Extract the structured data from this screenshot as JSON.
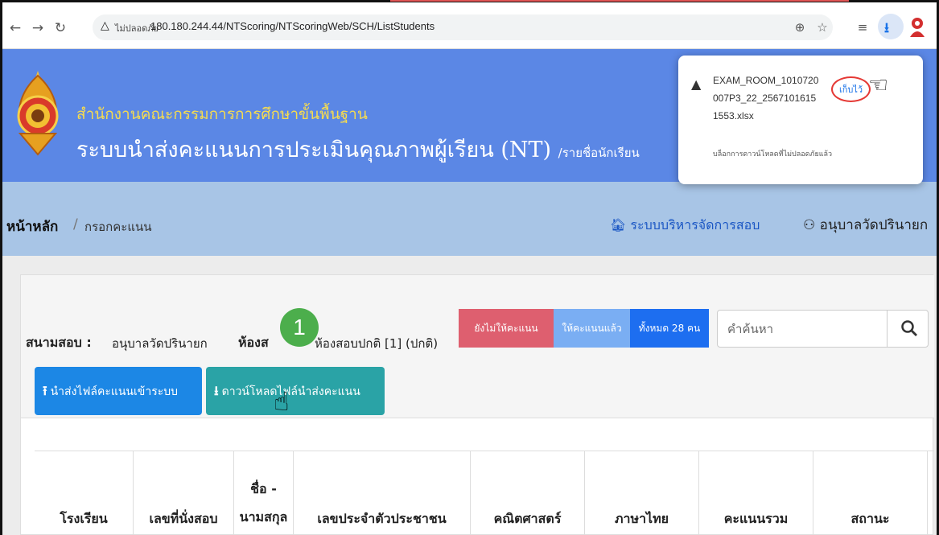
{
  "browser": {
    "not_secure": "ไม่ปลอดภัย",
    "url": "180.180.244.44/NTScoring/NTScoringWeb/SCH/ListStudents"
  },
  "download_popup": {
    "file_name_line1": "EXAM_ROOM_1010720",
    "file_name_line2": "007P3_22_2567101615",
    "file_name_line3": "1553.xlsx",
    "note": "บล็อกการดาวน์โหลดที่ไม่ปลอดภัยแล้ว",
    "keep_label": "เก็บไว้"
  },
  "header": {
    "org_name": "สำนักงานคณะกรรมการการศึกษาขั้นพื้นฐาน",
    "title": "ระบบนำส่งคะแนนการประเมินคุณภาพผู้เรียน (NT)",
    "subtitle": "/รายชื่อนักเรียน"
  },
  "breadcrumb": {
    "home": "หน้าหลัก",
    "separator": "/",
    "current": "กรอกคะแนน",
    "admin_link": "ระบบบริหารจัดการสอบ",
    "user": "อนุบาลวัดปรินายก"
  },
  "exam": {
    "venue_label": "สนามสอบ :",
    "venue_value": "อนุบาลวัดปรินายก",
    "room_label": "ห้องส",
    "room_value": "ห้องสอบปกติ [1] (ปกติ)",
    "step_number": "1"
  },
  "filters": {
    "no_score": "ยังไม่ให้คะแนน",
    "scored": "ให้คะแนนแล้ว",
    "total": "ทั้งหมด 28 คน"
  },
  "search": {
    "placeholder": "คำค้นหา"
  },
  "actions": {
    "upload": "นำส่งไฟล์คะแนนเข้าระบบ",
    "download": "ดาวน์โหลดไฟล์นำส่งคะแนน"
  },
  "table": {
    "columns": [
      "โรงเรียน",
      "เลขที่นั่งสอบ",
      "ชื่อ -",
      "นามสกุล",
      "เลขประจำตัวประชาชน",
      "คณิตศาสตร์",
      "ภาษาไทย",
      "คะแนนรวม",
      "สถานะ"
    ]
  },
  "colors": {
    "header_bg": "#5b87e5",
    "org_name": "#f7dc4e",
    "breadcrumb_bg": "#a8c5e6",
    "no_score": "#de5f6f",
    "scored": "#7aaef3",
    "total": "#1d6ef0",
    "upload_btn": "#1c87e5",
    "download_btn": "#2aa3a6",
    "step_badge": "#4cae4c"
  }
}
